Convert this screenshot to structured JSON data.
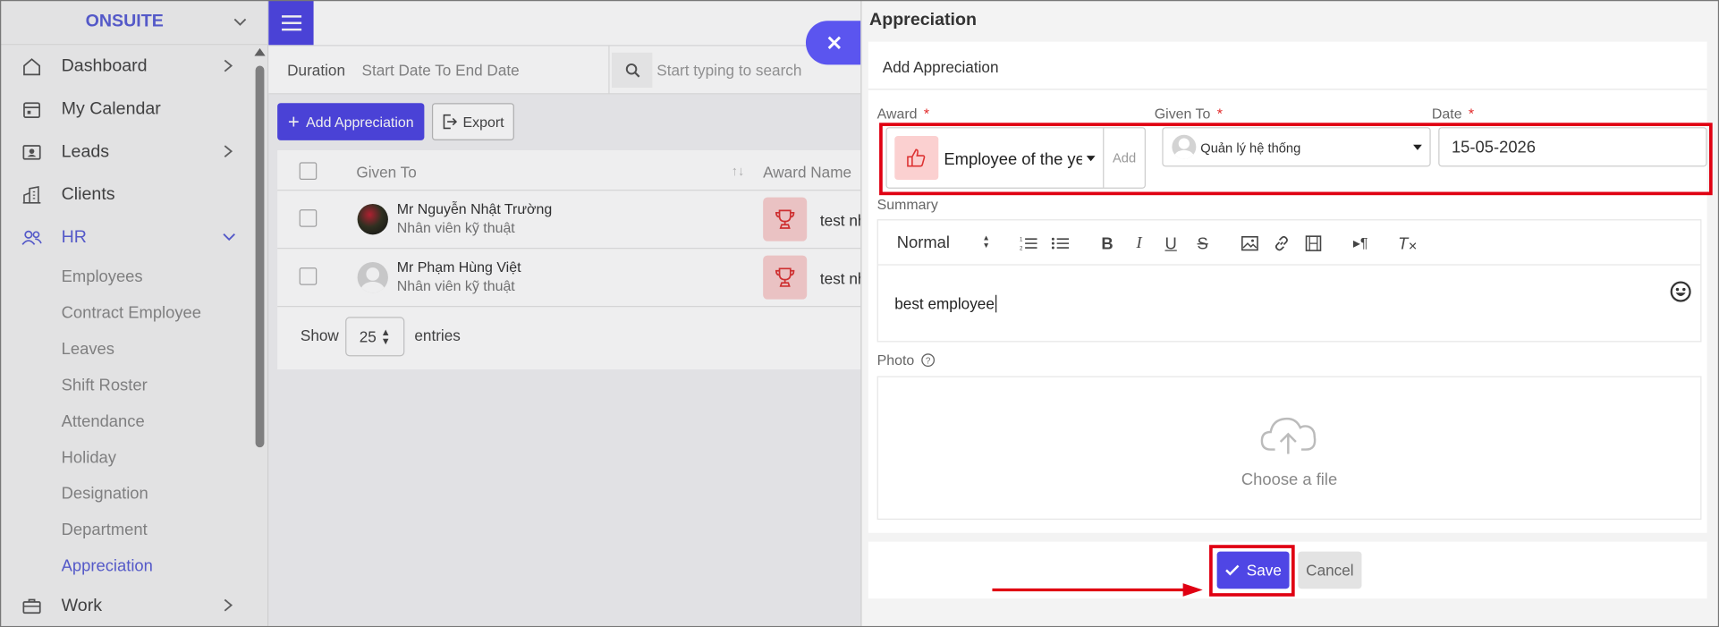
{
  "sidebar": {
    "brand": "ONSUITE",
    "items": [
      {
        "label": "Dashboard",
        "icon": "home-icon",
        "has_arrow": true
      },
      {
        "label": "My Calendar",
        "icon": "calendar-icon",
        "has_arrow": false
      },
      {
        "label": "Leads",
        "icon": "contact-card-icon",
        "has_arrow": true
      },
      {
        "label": "Clients",
        "icon": "building-icon",
        "has_arrow": false
      },
      {
        "label": "HR",
        "icon": "people-icon",
        "has_arrow": true,
        "expanded": true
      }
    ],
    "hr_submenu": [
      "Employees",
      "Contract Employee",
      "Leaves",
      "Shift Roster",
      "Attendance",
      "Holiday",
      "Designation",
      "Department",
      "Appreciation"
    ],
    "active_submenu": "Appreciation",
    "work_label": "Work"
  },
  "filter": {
    "duration_label": "Duration",
    "range": "Start Date To End Date",
    "search_placeholder": "Start typing to search"
  },
  "actions": {
    "add_label": "Add Appreciation",
    "export_label": "Export"
  },
  "table": {
    "headers": {
      "given_to": "Given To",
      "award_name": "Award Name"
    },
    "rows": [
      {
        "name": "Mr Nguyễn Nhật Trường",
        "role": "Nhân viên kỹ thuật",
        "award": "test nh"
      },
      {
        "name": "Mr Phạm Hùng Việt",
        "role": "Nhân viên kỹ thuật",
        "award": "test nh"
      }
    ],
    "show_label": "Show",
    "page_size": "25",
    "entries_label": "entries"
  },
  "panel": {
    "title": "Appreciation",
    "form_title": "Add Appreciation",
    "award_label": "Award",
    "award_value": "Employee of the year",
    "award_add": "Add",
    "given_to_label": "Given To",
    "given_to_value": "Quản lý hệ thống",
    "date_label": "Date",
    "date_value": "15-05-2026",
    "summary_label": "Summary",
    "text_style": "Normal",
    "summary_text": "best employee",
    "photo_label": "Photo",
    "choose_file": "Choose a file",
    "save_label": "Save",
    "cancel_label": "Cancel"
  },
  "colors": {
    "accent": "#4f46e5",
    "highlight": "#e00012",
    "award_bg": "#fbd0d0"
  },
  "required_mark": "*"
}
